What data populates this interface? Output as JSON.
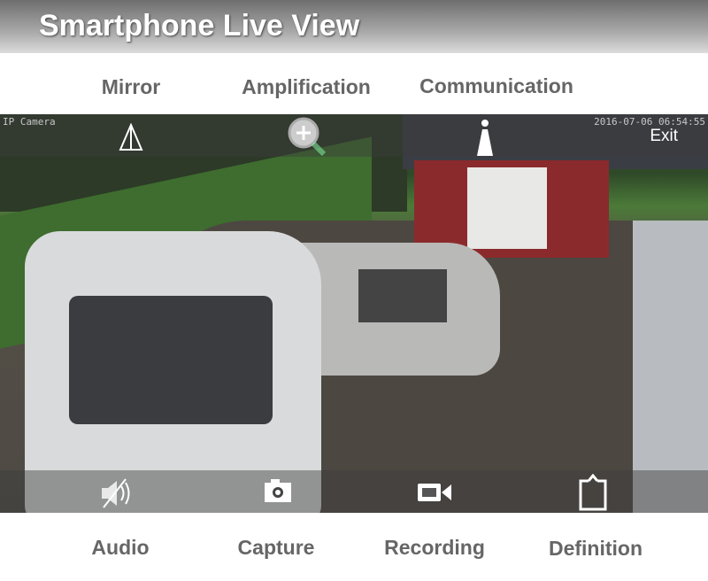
{
  "header": {
    "title": "Smartphone Live View"
  },
  "top_labels": [
    "Mirror",
    "Amplification",
    "Communication"
  ],
  "bottom_labels": [
    "Audio",
    "Capture",
    "Recording",
    "Definition"
  ],
  "overlay": {
    "camera_name": "IP Camera",
    "timestamp": "2016-07-06 06:54:55",
    "exit": "Exit"
  }
}
